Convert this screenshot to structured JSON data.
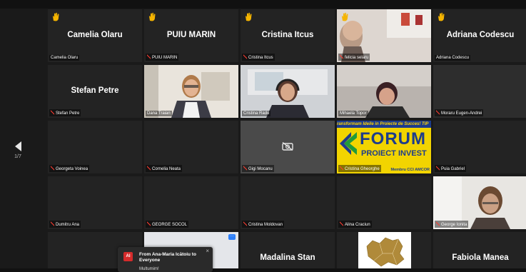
{
  "pager": {
    "page": "1/7"
  },
  "tiles": [
    {
      "name": "Camelia Olaru",
      "label": "Camelia Olaru",
      "hand": true,
      "muted": false
    },
    {
      "name": "PUIU MARIN",
      "label": "PUIU MARIN",
      "hand": true,
      "muted": true
    },
    {
      "name": "Cristina Itcus",
      "label": "Cristina Itcus",
      "hand": true,
      "muted": true
    },
    {
      "name": "",
      "label": "felicia selaru",
      "hand": true,
      "muted": true
    },
    {
      "name": "Adriana Codescu",
      "label": "Adriana Codescu",
      "hand": true,
      "muted": false
    },
    {
      "name": "Stefan Petre",
      "label": "Stefan Petre",
      "hand": false,
      "muted": true
    },
    {
      "name": "",
      "label": "Dana Traian",
      "hand": false,
      "muted": false
    },
    {
      "name": "",
      "label": "Cristina Radu",
      "hand": false,
      "muted": false
    },
    {
      "name": "",
      "label": "Mihaela Topor",
      "hand": false,
      "muted": false
    },
    {
      "name": "",
      "label": "Moraru Eugen-Andrei",
      "hand": false,
      "muted": true
    },
    {
      "name": "",
      "label": "Georgeta Voinea",
      "hand": false,
      "muted": true
    },
    {
      "name": "",
      "label": "Cornelia Neata",
      "hand": false,
      "muted": true
    },
    {
      "name": "",
      "label": "Gigi Mocanu",
      "hand": false,
      "muted": true
    },
    {
      "name": "",
      "label": "Cristina Gheorghe",
      "hand": false,
      "muted": true
    },
    {
      "name": "",
      "label": "Puia Gabriel",
      "hand": false,
      "muted": true
    },
    {
      "name": "",
      "label": "Dumitru Ana",
      "hand": false,
      "muted": true
    },
    {
      "name": "",
      "label": "GEORGE SOCOL",
      "hand": false,
      "muted": true
    },
    {
      "name": "",
      "label": "Cristina Moldovan",
      "hand": false,
      "muted": true
    },
    {
      "name": "",
      "label": "Alina Craciun",
      "hand": false,
      "muted": true
    },
    {
      "name": "",
      "label": "George Ionita",
      "hand": false,
      "muted": true
    },
    {
      "name": "",
      "label": "",
      "hand": false,
      "muted": false
    },
    {
      "name": "",
      "label": "",
      "hand": false,
      "muted": false
    },
    {
      "name": "Madalina Stan",
      "label": "",
      "hand": false,
      "muted": false
    },
    {
      "name": "",
      "label": "",
      "hand": false,
      "muted": false
    },
    {
      "name": "Fabiola Manea",
      "label": "",
      "hand": false,
      "muted": false
    }
  ],
  "forum_logo": {
    "banner": "ransformam Ideile in Proiecte de Succes! TIP",
    "brand": "FORUM",
    "sub": "PROIECT INVEST",
    "tag": "Membru CCI AMCOR"
  },
  "chat_popup": {
    "avatar_initials": "AI",
    "title": "From Ana-Maria Icătoiu to Everyone",
    "message": "Multumim!",
    "close_label": "×"
  },
  "colors": {
    "active_speaker": "#d6e33e",
    "muted_red": "#ff3b30",
    "hand_yellow": "#f5b400"
  }
}
